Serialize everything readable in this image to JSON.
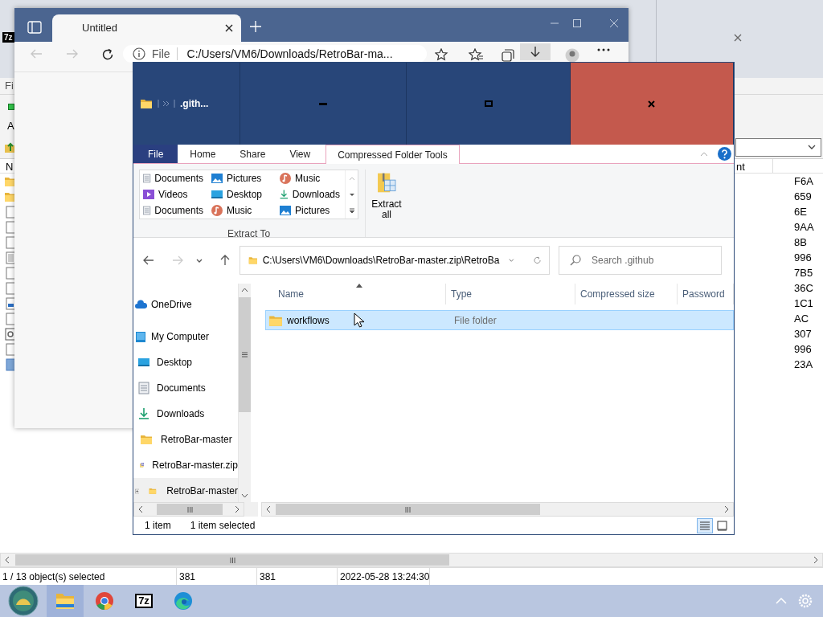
{
  "archive_window": {
    "logo": "7z",
    "menu_fragment": "Fi",
    "toolbar_fragment": "A",
    "columns": [
      {
        "label": "N"
      },
      {
        "label": "nt"
      }
    ],
    "rows": [
      {
        "kind": "folder",
        "column_2": "F6A"
      },
      {
        "kind": "folder",
        "column_2": "659"
      },
      {
        "kind": "file",
        "column_2": "6E"
      },
      {
        "kind": "file",
        "column_2": "9AA"
      },
      {
        "kind": "file",
        "column_2": "8B"
      },
      {
        "kind": "text",
        "column_2": "996"
      },
      {
        "kind": "file",
        "column_2": "7B5"
      },
      {
        "kind": "file",
        "column_2": "36C"
      },
      {
        "kind": "image",
        "column_2": "1C1"
      },
      {
        "kind": "file",
        "column_2": "AC"
      },
      {
        "kind": "settings",
        "column_2": "307"
      },
      {
        "kind": "file",
        "column_2": "996"
      },
      {
        "kind": "block",
        "column_2": "23A"
      }
    ],
    "status_bar": [
      "1 / 13 object(s) selected",
      "381",
      "381",
      "2022-05-28 13:24:30"
    ]
  },
  "browser": {
    "tab": {
      "title": "Untitled"
    },
    "address": {
      "label": "File",
      "url": "C:/Users/VM6/Downloads/RetroBar-ma..."
    }
  },
  "explorer": {
    "title": ".gith...",
    "ribbon_tabs": [
      {
        "label": "File",
        "kind": "menu",
        "selected": false
      },
      {
        "label": "Home",
        "kind": "tab",
        "selected": false
      },
      {
        "label": "Share",
        "kind": "tab",
        "selected": false
      },
      {
        "label": "View",
        "kind": "tab",
        "selected": false
      },
      {
        "label": "Compressed Folder Tools",
        "kind": "context",
        "selected": true
      }
    ],
    "extract_to": {
      "label": "Extract To",
      "items": [
        {
          "label": "Documents",
          "kind": "documents"
        },
        {
          "label": "Pictures",
          "kind": "pictures"
        },
        {
          "label": "Music",
          "kind": "music"
        },
        {
          "label": "Videos",
          "kind": "videos"
        },
        {
          "label": "Desktop",
          "kind": "desktop"
        },
        {
          "label": "Downloads",
          "kind": "downloads"
        },
        {
          "label": "Documents",
          "kind": "documents"
        },
        {
          "label": "Music",
          "kind": "music"
        },
        {
          "label": "Pictures",
          "kind": "pictures"
        }
      ]
    },
    "extract_all": "Extract all",
    "address": "C:\\Users\\VM6\\Downloads\\RetroBar-master.zip\\RetroBa",
    "search": {
      "placeholder": "Search .github"
    },
    "nav_pane": [
      {
        "label": "OneDrive",
        "kind": "onedrive",
        "selected": false
      },
      {
        "label": "My Computer",
        "kind": "computer",
        "selected": false,
        "children": [
          {
            "label": "Desktop",
            "kind": "desktop",
            "selected": false
          },
          {
            "label": "Documents",
            "kind": "documents",
            "selected": false
          },
          {
            "label": "Downloads",
            "kind": "downloads",
            "selected": false,
            "children": [
              {
                "label": "RetroBar-master",
                "kind": "folder",
                "selected": false
              },
              {
                "label": "RetroBar-master.zip",
                "kind": "zip",
                "selected": false,
                "children": [
                  {
                    "label": "RetroBar-master",
                    "kind": "folder",
                    "selected": true,
                    "expanded": false
                  }
                ]
              }
            ]
          }
        ]
      }
    ],
    "columns": [
      {
        "label": "Name",
        "sorted": true
      },
      {
        "label": "Type",
        "sorted": false
      },
      {
        "label": "Compressed size",
        "sorted": false
      },
      {
        "label": "Password",
        "sorted": false
      }
    ],
    "rows": [
      {
        "name": "workflows",
        "type": "File folder",
        "selected": true
      }
    ],
    "status": {
      "count": "1 item",
      "selection": "1 item selected"
    },
    "views": [
      {
        "kind": "details",
        "selected": true
      },
      {
        "kind": "tiles",
        "selected": false
      }
    ]
  },
  "taskbar": [
    {
      "kind": "start",
      "selected": false
    },
    {
      "kind": "explorer",
      "selected": true
    },
    {
      "kind": "chrome",
      "selected": false
    },
    {
      "kind": "archiver",
      "label": "7z",
      "selected": false
    },
    {
      "kind": "edge",
      "selected": false
    }
  ]
}
